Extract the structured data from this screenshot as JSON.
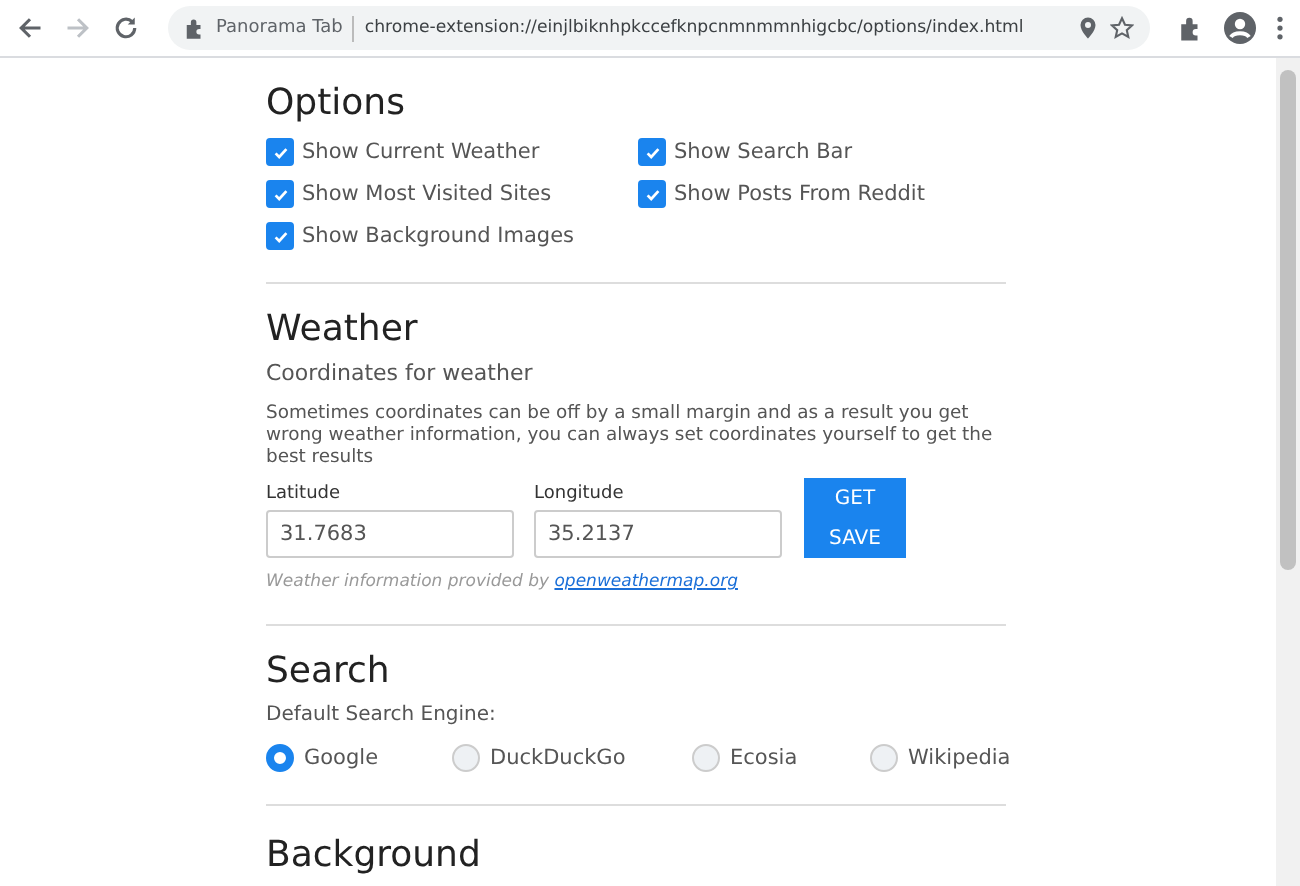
{
  "browser": {
    "tab_label": "Panorama Tab",
    "url": "chrome-extension://einjlbiknhpkccefknpcnmnmmnhigcbc/options/index.html"
  },
  "options": {
    "title": "Options",
    "checkboxes": [
      {
        "label": "Show Current Weather",
        "checked": true
      },
      {
        "label": "Show Search Bar",
        "checked": true
      },
      {
        "label": "Show Most Visited Sites",
        "checked": true
      },
      {
        "label": "Show Posts From Reddit",
        "checked": true
      },
      {
        "label": "Show Background Images",
        "checked": true
      }
    ]
  },
  "weather": {
    "title": "Weather",
    "subtitle": "Coordinates for weather",
    "description": "Sometimes coordinates can be off by a small margin and as a result you get wrong weather information, you can always set coordinates yourself to get the best results",
    "fields": [
      {
        "label": "Latitude",
        "value": "31.7683"
      },
      {
        "label": "Longitude",
        "value": "35.2137"
      }
    ],
    "buttons": [
      "GET",
      "SAVE"
    ],
    "credit": "Weather information provided by",
    "credit_link": "openweathermap.org"
  },
  "search": {
    "title": "Search",
    "label": "Default Search Engine:",
    "engines": [
      {
        "label": "Google",
        "selected": true
      },
      {
        "label": "DuckDuckGo",
        "selected": false
      },
      {
        "label": "Ecosia",
        "selected": false
      },
      {
        "label": "Wikipedia",
        "selected": false
      }
    ]
  },
  "background": {
    "title": "Background"
  }
}
